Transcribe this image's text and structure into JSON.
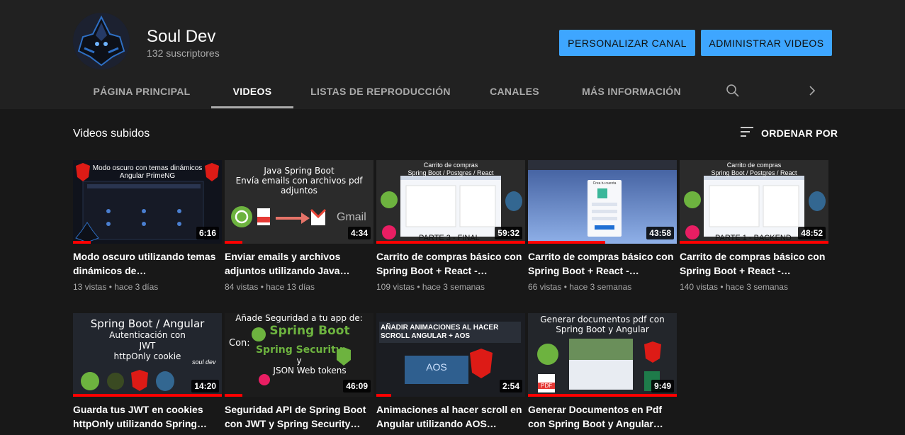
{
  "channel": {
    "name": "Soul Dev",
    "subscribers": "132 suscriptores",
    "customize_label": "PERSONALIZAR CANAL",
    "manage_label": "ADMINISTRAR VIDEOS"
  },
  "tabs": [
    {
      "label": "PÁGINA PRINCIPAL"
    },
    {
      "label": "VIDEOS"
    },
    {
      "label": "LISTAS DE REPRODUCCIÓN"
    },
    {
      "label": "CANALES"
    },
    {
      "label": "MÁS INFORMACIÓN"
    }
  ],
  "icons": {
    "search": "search-icon",
    "next": "chevron-right-icon",
    "sort": "sort-icon"
  },
  "section": {
    "title": "Videos subidos",
    "sort_label": "ORDENAR POR"
  },
  "colors": {
    "accent": "#3ea6ff",
    "progress": "#ff0000",
    "background": "#181818",
    "header": "#212121"
  },
  "videos": [
    {
      "title": "Modo oscuro utilizando temas dinámicos de…",
      "views": "13 vistas",
      "age": "hace 3 días",
      "duration": "6:16",
      "watched": 0.12,
      "thumb_lines": [
        "Modo oscuro con temas dinámicos",
        "Angular PrimeNG"
      ]
    },
    {
      "title": "Enviar emails y archivos adjuntos utilizando Java…",
      "views": "84 vistas",
      "age": "hace 13 días",
      "duration": "4:34",
      "watched": 0.12,
      "thumb_lines": [
        "Java Spring Boot",
        "Envía emails con archivos pdf",
        "adjuntos"
      ],
      "thumb_extra": "Gmail"
    },
    {
      "title": "Carrito de compras básico con Spring Boot + React -…",
      "views": "109 vistas",
      "age": "hace 3 semanas",
      "duration": "59:32",
      "watched": 1,
      "thumb_lines": [
        "Carrito de compras",
        "Spring Boot / Postgres / React"
      ],
      "thumb_extra": "PARTE 3 - FINAL"
    },
    {
      "title": "Carrito de compras básico con Spring Boot + React -…",
      "views": "66 vistas",
      "age": "hace 3 semanas",
      "duration": "43:58",
      "watched": 0.52,
      "thumb_lines": [],
      "thumb_extra": "Crea tu cuenta"
    },
    {
      "title": "Carrito de compras básico con Spring Boot + React -…",
      "views": "140 vistas",
      "age": "hace 3 semanas",
      "duration": "48:52",
      "watched": 1,
      "thumb_lines": [
        "Carrito de compras",
        "Spring Boot / Postgres / React"
      ],
      "thumb_extra": "PARTE 1 - BACKEND"
    },
    {
      "title": "Guarda tus JWT en cookies httpOnly utilizando Spring…",
      "views": "",
      "age": "",
      "duration": "14:20",
      "watched": 1,
      "thumb_lines": [
        "Spring Boot / Angular",
        "Autenticación con",
        "JWT",
        "httpOnly cookie"
      ],
      "thumb_extra": "soul dev"
    },
    {
      "title": "Seguridad API de Spring Boot con JWT y Spring Security…",
      "views": "",
      "age": "",
      "duration": "46:09",
      "watched": 0.12,
      "thumb_lines": [
        "Añade Seguridad a tu app de:",
        "Spring Boot",
        "Con:",
        "Spring Security",
        "y",
        "JSON Web tokens"
      ]
    },
    {
      "title": "Animaciones al hacer scroll en Angular utilizando AOS…",
      "views": "",
      "age": "",
      "duration": "2:54",
      "watched": 0.1,
      "thumb_lines": [
        "AÑADIR ANIMACIONES AL HACER",
        "SCROLL ANGULAR + AOS"
      ],
      "thumb_extra": "AOS"
    },
    {
      "title": "Generar Documentos en Pdf con Spring Boot y Angular…",
      "views": "",
      "age": "",
      "duration": "9:49",
      "watched": 1,
      "thumb_lines": [
        "Generar documentos pdf con",
        "Spring Boot y Angular"
      ],
      "thumb_extra": "PDF"
    }
  ]
}
